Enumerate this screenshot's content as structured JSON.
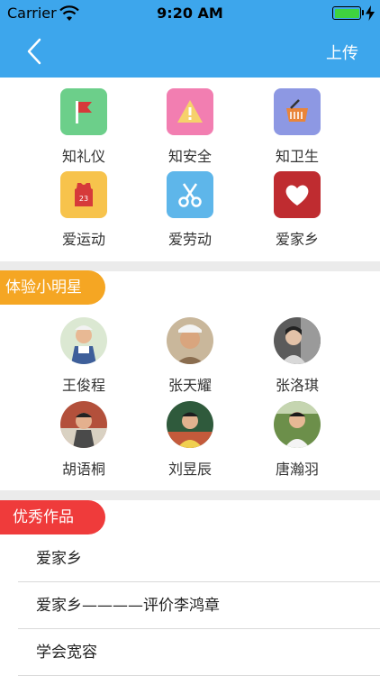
{
  "status_bar": {
    "carrier": "Carrier",
    "time": "9:20 AM"
  },
  "nav_bar": {
    "action_label": "上传",
    "accent_color": "#3da6ec"
  },
  "categories": [
    {
      "label": "知礼仪",
      "icon": "flag-icon",
      "color": "#6ccf8a"
    },
    {
      "label": "知安全",
      "icon": "warning-icon",
      "color": "#f27eb1"
    },
    {
      "label": "知卫生",
      "icon": "basket-icon",
      "color": "#8d98e3"
    },
    {
      "label": "爱运动",
      "icon": "jersey-icon",
      "color": "#f7c34c"
    },
    {
      "label": "爱劳动",
      "icon": "scissors-icon",
      "color": "#5eb6ea"
    },
    {
      "label": "爱家乡",
      "icon": "heart-icon",
      "color": "#bf2c30"
    }
  ],
  "star_section": {
    "tag": "体验小明星",
    "tag_color": "#f5a623",
    "people": [
      {
        "name": "王俊程"
      },
      {
        "name": "张天耀"
      },
      {
        "name": "张洛琪"
      },
      {
        "name": "胡语桐"
      },
      {
        "name": "刘昱辰"
      },
      {
        "name": "唐瀚羽"
      }
    ]
  },
  "works_section": {
    "tag": "优秀作品",
    "tag_color": "#ef3b3b",
    "items": [
      {
        "title": "爱家乡"
      },
      {
        "title": "爱家乡————评价李鸿章"
      },
      {
        "title": "学会宽容"
      }
    ]
  }
}
